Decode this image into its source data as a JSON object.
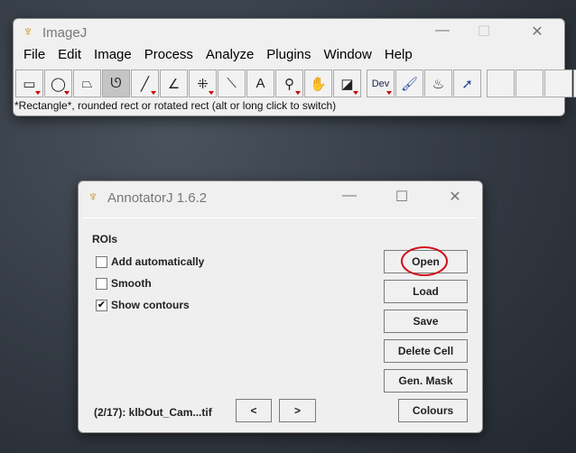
{
  "imagej": {
    "title": "ImageJ",
    "menu": [
      "File",
      "Edit",
      "Image",
      "Process",
      "Analyze",
      "Plugins",
      "Window",
      "Help"
    ],
    "tools": [
      {
        "icon": "rectangle-icon",
        "glyph": "▭"
      },
      {
        "icon": "oval-icon",
        "glyph": "◯"
      },
      {
        "icon": "polygon-icon",
        "glyph": "⏢"
      },
      {
        "icon": "freehand-icon",
        "glyph": "ᘎ"
      },
      {
        "icon": "line-icon",
        "glyph": "╱"
      },
      {
        "icon": "angle-icon",
        "glyph": "∠"
      },
      {
        "icon": "multipoint-icon",
        "glyph": "⁜"
      },
      {
        "icon": "wand-icon",
        "glyph": "⟍"
      },
      {
        "icon": "text-icon",
        "glyph": "A"
      },
      {
        "icon": "magnifier-icon",
        "glyph": "⚲"
      },
      {
        "icon": "hand-icon",
        "glyph": "✋"
      },
      {
        "icon": "color-picker-icon",
        "glyph": "◪"
      },
      {
        "icon": "dev-icon",
        "glyph": "Dev"
      },
      {
        "icon": "brush-icon",
        "glyph": "🖌"
      },
      {
        "icon": "flood-fill-icon",
        "glyph": "♨"
      },
      {
        "icon": "arrow-icon",
        "glyph": "➚"
      },
      {
        "icon": "empty-slot",
        "glyph": ""
      },
      {
        "icon": "empty-slot",
        "glyph": ""
      },
      {
        "icon": "empty-slot",
        "glyph": ""
      },
      {
        "icon": "more-tools-icon",
        "glyph": "≫"
      }
    ],
    "status": "*Rectangle*, rounded rect or rotated rect (alt or long click to switch)"
  },
  "annotator": {
    "title": "AnnotatorJ 1.6.2",
    "rois_label": "ROIs",
    "checkboxes": [
      {
        "label": "Add automatically",
        "checked": false
      },
      {
        "label": "Smooth",
        "checked": false
      },
      {
        "label": "Show contours",
        "checked": true
      }
    ],
    "buttons": {
      "open": "Open",
      "load": "Load",
      "save": "Save",
      "delete": "Delete Cell",
      "mask": "Gen. Mask",
      "colours": "Colours",
      "prev": "<",
      "next": ">"
    },
    "file_label": "(2/17): klbOut_Cam...tif",
    "highlight_color": "#d0101a"
  }
}
